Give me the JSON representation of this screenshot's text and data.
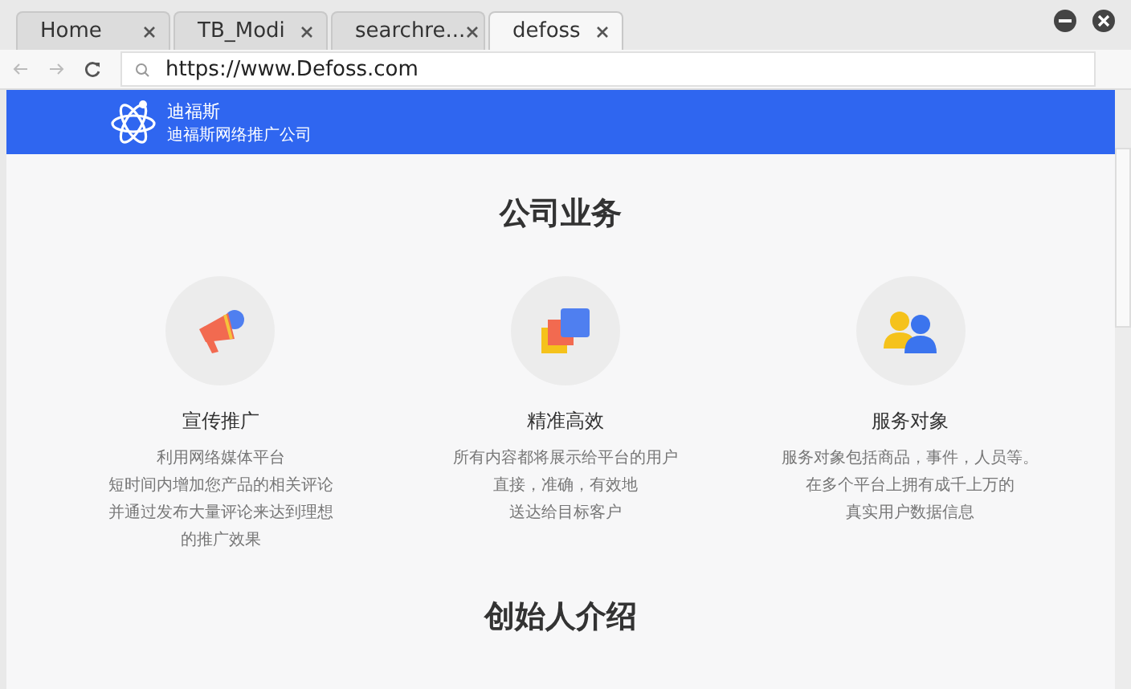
{
  "browser": {
    "tabs": [
      {
        "label": "Home",
        "selected": false
      },
      {
        "label": "TB_Modi",
        "selected": false
      },
      {
        "label": "searchre...",
        "selected": false
      },
      {
        "label": "defoss",
        "selected": true
      }
    ],
    "url": "https://www.Defoss.com"
  },
  "header": {
    "brand": "迪福斯",
    "subtitle": "迪福斯网络推广公司"
  },
  "section_title": "公司业务",
  "services": [
    {
      "kind": "megaphone",
      "title": "宣传推广",
      "lines": [
        "利用网络媒体平台",
        "短时间内增加您产品的相关评论",
        "并通过发布大量评论来达到理想",
        "的推广效果"
      ]
    },
    {
      "kind": "layers",
      "title": "精准高效",
      "lines": [
        "所有内容都将展示给平台的用户",
        "直接，准确，有效地",
        "送达给目标客户"
      ]
    },
    {
      "kind": "people",
      "title": "服务对象",
      "lines": [
        "服务对象包括商品，事件，人员等。",
        "在多个平台上拥有成千上万的",
        "真实用户数据信息"
      ]
    }
  ],
  "next_section_title": "创始人介绍"
}
